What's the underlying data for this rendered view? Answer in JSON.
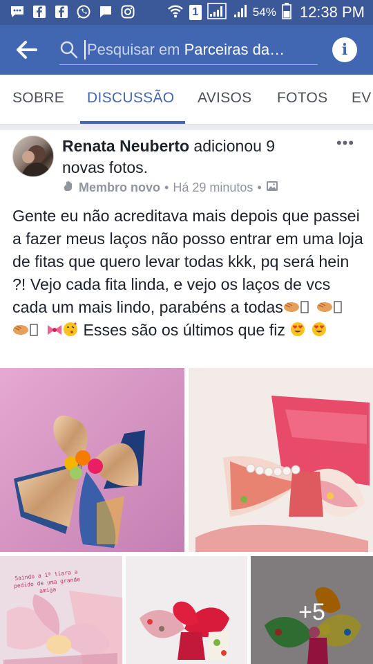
{
  "status_bar": {
    "battery_percent": "54%",
    "time": "12:38 PM",
    "sim_label": "1",
    "left_icons": [
      "chat-bubble-icon",
      "facebook-icon",
      "facebook-icon",
      "whatsapp-icon",
      "message-icon",
      "instagram-icon"
    ],
    "right_icons": [
      "wifi-icon",
      "sim1-icon",
      "signal-icon",
      "signal-icon",
      "battery-icon"
    ]
  },
  "header": {
    "search_prefix": "Pesquisar em ",
    "search_group": "Parceiras da…",
    "info_label": "i"
  },
  "tabs": [
    {
      "label": "SOBRE",
      "active": false
    },
    {
      "label": "DISCUSSÃO",
      "active": true
    },
    {
      "label": "AVISOS",
      "active": false
    },
    {
      "label": "FOTOS",
      "active": false
    },
    {
      "label": "EV",
      "active": false
    }
  ],
  "post": {
    "author": "Renata Neuberto",
    "action": " adicionou 9 novas fotos.",
    "badge": "Membro novo",
    "separator": "•",
    "time": "Há 29 minutos",
    "more_label": "•••",
    "text_part1": "Gente eu não acreditava mais depois que passei a fazer meus laços não posso entrar em uma loja de fitas que quero levar todas kkk, pq será hein ?! Vejo cada fita linda, e vejo os laços de vcs cada um mais lindo, parabéns a todas",
    "text_part2": " Esses são os últimos que fiz ",
    "photo_note": "Saindo a 1ª tiara a pedido de uma grande amiga",
    "more_photos": "+5"
  },
  "colors": {
    "status_bar": "#3b5998",
    "header": "#4267b2",
    "accent": "#4267b2",
    "text": "#1d2129",
    "meta": "#90949c"
  }
}
